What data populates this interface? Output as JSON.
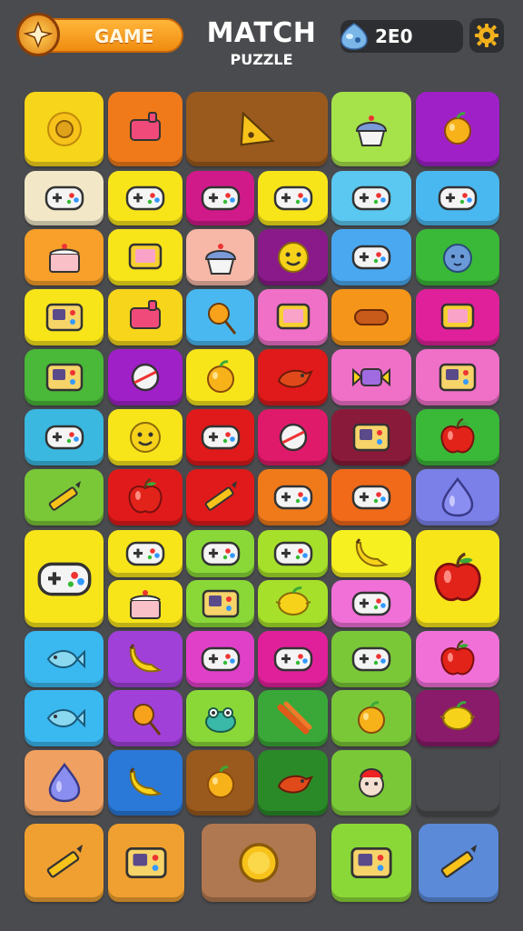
{
  "header": {
    "game_label": "GAME",
    "title_line1": "MATCH",
    "title_line2": "PUZZLE",
    "score": "2E0",
    "score_icon": "gem-icon",
    "settings_icon": "gear-icon"
  },
  "palette": {
    "background": "#4a4b4e",
    "accent_orange": "#f59a1e",
    "pill_dark": "#2d2e31"
  },
  "board": {
    "tiles": [
      {
        "color": "#f7d51a",
        "icon": "sunflower"
      },
      {
        "color": "#f07a1a",
        "icon": "toy"
      },
      {
        "color": "#9a5a1d",
        "icon": "pizza-slice"
      },
      {
        "color": "#a6e24a",
        "icon": "cupcake"
      },
      {
        "color": "#a020c8",
        "icon": "fruit"
      },
      {
        "color": "#f2e8c8",
        "icon": "gamepad"
      },
      {
        "color": "#f7e51a",
        "icon": "gamepad"
      },
      {
        "color": "#d01a8a",
        "icon": "gamepad"
      },
      {
        "color": "#f7e51a",
        "icon": "gamepad"
      },
      {
        "color": "#5ac8f0",
        "icon": "gamepad"
      },
      {
        "color": "#4ab8f0",
        "icon": "gamepad"
      },
      {
        "color": "#f8a02a",
        "icon": "cake"
      },
      {
        "color": "#f7e51a",
        "icon": "screen"
      },
      {
        "color": "#f7b8a8",
        "icon": "cupcake"
      },
      {
        "color": "#8a1a8a",
        "icon": "smiley"
      },
      {
        "color": "#4aa8f0",
        "icon": "gamepad"
      },
      {
        "color": "#3ab838",
        "icon": "blob"
      },
      {
        "color": "#f7e51a",
        "icon": "console"
      },
      {
        "color": "#f7d51a",
        "icon": "toy"
      },
      {
        "color": "#4ab8f0",
        "icon": "lollipop"
      },
      {
        "color": "#f070c8",
        "icon": "screen"
      },
      {
        "color": "#f5951a",
        "icon": "sausage"
      },
      {
        "color": "#e0209a",
        "icon": "screen"
      },
      {
        "color": "#4ab838",
        "icon": "console"
      },
      {
        "color": "#a020c8",
        "icon": "ball"
      },
      {
        "color": "#f7e51a",
        "icon": "fruit"
      },
      {
        "color": "#e01a1a",
        "icon": "bird"
      },
      {
        "color": "#f070c8",
        "icon": "candy"
      },
      {
        "color": "#f070c8",
        "icon": "console"
      },
      {
        "color": "#3ab8e0",
        "icon": "gamepad"
      },
      {
        "color": "#f7e51a",
        "icon": "smiley"
      },
      {
        "color": "#e01a1a",
        "icon": "gamepad"
      },
      {
        "color": "#e01a6a",
        "icon": "ball"
      },
      {
        "color": "#8a1a3a",
        "icon": "console"
      },
      {
        "color": "#3ab838",
        "icon": "apple"
      },
      {
        "color": "#7ac838",
        "icon": "pencil"
      },
      {
        "color": "#e01a1a",
        "icon": "apple"
      },
      {
        "color": "#e01a1a",
        "icon": "pencil"
      },
      {
        "color": "#f07a1a",
        "icon": "gamepad"
      },
      {
        "color": "#f06a1a",
        "icon": "gamepad"
      },
      {
        "color": "#7a80e8",
        "icon": "drop"
      },
      {
        "color": "#f7e51a",
        "icon": "gamepad"
      },
      {
        "color": "#f7e51a",
        "icon": "gamepad"
      },
      {
        "color": "#8ad838",
        "icon": "gamepad"
      },
      {
        "color": "#a6e02a",
        "icon": "gamepad"
      },
      {
        "color": "#f7f020",
        "icon": "banana"
      },
      {
        "color": "#f7e51a",
        "icon": "apple"
      },
      {
        "color": "#f7e51a",
        "icon": "cake"
      },
      {
        "color": "#8ad838",
        "icon": "console"
      },
      {
        "color": "#a6e02a",
        "icon": "lemon"
      },
      {
        "color": "#f070d8",
        "icon": "gamepad"
      },
      {
        "color": "#3ab8f0",
        "icon": "fish"
      },
      {
        "color": "#a040d8",
        "icon": "banana"
      },
      {
        "color": "#e040c8",
        "icon": "gamepad"
      },
      {
        "color": "#e0209a",
        "icon": "gamepad"
      },
      {
        "color": "#7ac838",
        "icon": "gamepad"
      },
      {
        "color": "#f070d8",
        "icon": "apple"
      },
      {
        "color": "#3ab8f0",
        "icon": "fish"
      },
      {
        "color": "#a040d8",
        "icon": "lollipop"
      },
      {
        "color": "#8ad838",
        "icon": "frog"
      },
      {
        "color": "#3aa838",
        "icon": "carrot"
      },
      {
        "color": "#7ac838",
        "icon": "fruit"
      },
      {
        "color": "#8a1a6a",
        "icon": "lemon"
      },
      {
        "color": "#f0a060",
        "icon": "drop"
      },
      {
        "color": "#2a78d8",
        "icon": "banana"
      },
      {
        "color": "#9a5a1d",
        "icon": "fruit"
      },
      {
        "color": "#2a8a28",
        "icon": "bird"
      },
      {
        "color": "#7ac838",
        "icon": "monster"
      }
    ]
  },
  "bottom_buttons": [
    {
      "name": "pencil-button",
      "color": "#f0a030",
      "icon": "pencil"
    },
    {
      "name": "treasure-button",
      "color": "#f0a030",
      "icon": "console"
    },
    {
      "name": "coin-button",
      "color": "#b07850",
      "icon": "coin"
    },
    {
      "name": "screen-button",
      "color": "#8ad838",
      "icon": "console"
    },
    {
      "name": "tool-button",
      "color": "#5a8ad8",
      "icon": "pencil"
    }
  ]
}
